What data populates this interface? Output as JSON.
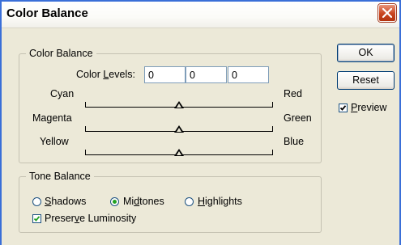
{
  "window": {
    "title": "Color Balance"
  },
  "color_balance": {
    "group_label": "Color Balance",
    "levels_label_pre": "Color ",
    "levels_label_accel": "L",
    "levels_label_post": "evels:",
    "levels": [
      "0",
      "0",
      "0"
    ],
    "sliders": [
      {
        "left": "Cyan",
        "right": "Red",
        "value": 0
      },
      {
        "left": "Magenta",
        "right": "Green",
        "value": 0
      },
      {
        "left": "Yellow",
        "right": "Blue",
        "value": 0
      }
    ]
  },
  "tone_balance": {
    "group_label": "Tone Balance",
    "shadows": {
      "accel": "S",
      "rest": "hadows",
      "selected": false
    },
    "midtones": {
      "pre": "Mi",
      "accel": "d",
      "rest": "tones",
      "selected": true
    },
    "highlights": {
      "accel": "H",
      "rest": "ighlights",
      "selected": false
    },
    "preserve": {
      "pre": "Preser",
      "accel": "v",
      "rest": "e Luminosity",
      "checked": true
    }
  },
  "buttons": {
    "ok": "OK",
    "reset": "Reset"
  },
  "preview": {
    "accel": "P",
    "rest": "review",
    "checked": true
  }
}
